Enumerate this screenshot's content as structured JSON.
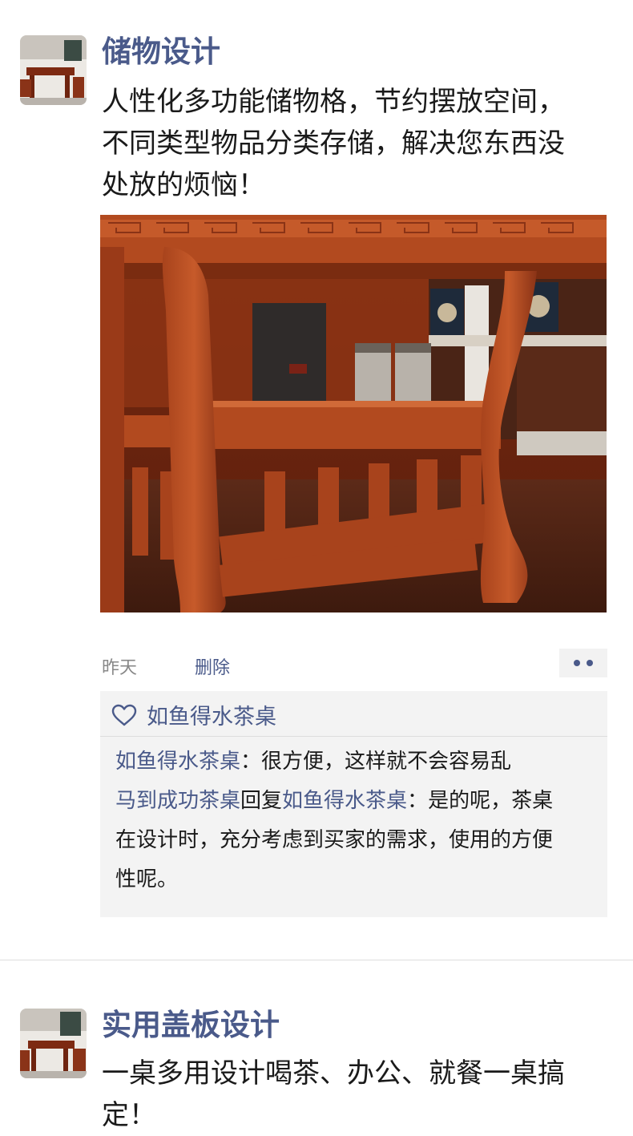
{
  "post1": {
    "author": "储物设计",
    "text_lines": [
      "人性化多功能储物格，节约摆放空间，",
      "不同类型物品分类存储，解决您东西没",
      "处放的烦恼！"
    ],
    "time": "昨天",
    "delete_label": "删除",
    "likes": {
      "liker": "如鱼得水茶桌"
    },
    "comments": [
      {
        "author": "如鱼得水茶桌",
        "sep": "：",
        "text": "很方便，这样就不会容易乱"
      },
      {
        "author": "马到成功茶桌",
        "reply_word": "回复",
        "reply_to": "如鱼得水茶桌",
        "sep": "：",
        "text": "是的呢，茶桌",
        "cont_lines": [
          "在设计时，充分考虑到买家的需求，使用的方便",
          "性呢。"
        ]
      }
    ]
  },
  "post2": {
    "author": "实用盖板设计",
    "text_lines": [
      "一桌多用设计喝茶、办公、就餐一桌搞",
      "定！"
    ]
  },
  "colors": {
    "link": "#4a5a8a",
    "comment_bg": "#f3f3f3",
    "wood": "#8f3516"
  },
  "icons": [
    "heart-icon",
    "more-dots-icon"
  ]
}
